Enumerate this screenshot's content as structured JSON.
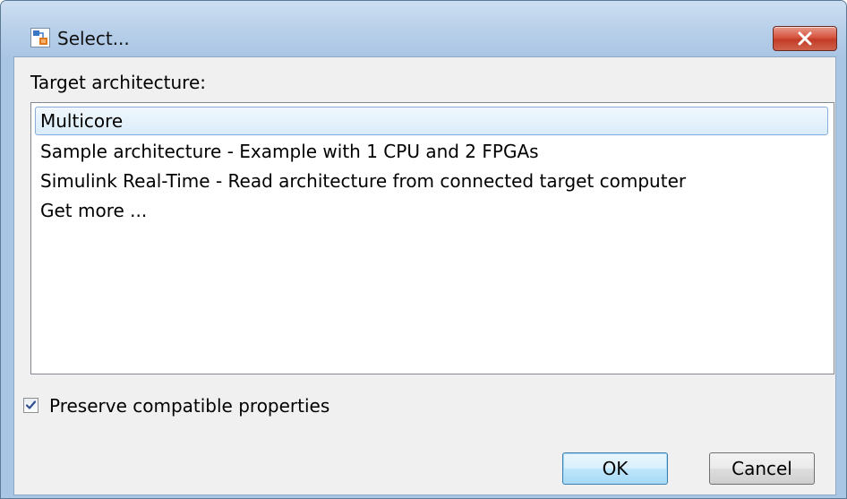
{
  "window": {
    "title": "Select...",
    "icon": "simulink-model-icon",
    "close_icon": "close-icon"
  },
  "target_label": "Target architecture:",
  "architectures": [
    {
      "label": "Multicore",
      "selected": true
    },
    {
      "label": "Sample architecture - Example with 1 CPU and 2 FPGAs",
      "selected": false
    },
    {
      "label": "Simulink Real-Time - Read architecture from connected target computer",
      "selected": false
    },
    {
      "label": "Get more ...",
      "selected": false
    }
  ],
  "preserve": {
    "label": "Preserve compatible properties",
    "checked": true
  },
  "buttons": {
    "ok_label": "OK",
    "cancel_label": "Cancel"
  },
  "colors": {
    "titlebar": "#b7cfe9",
    "close_button": "#c23c27",
    "selection_border": "#84acdd"
  }
}
